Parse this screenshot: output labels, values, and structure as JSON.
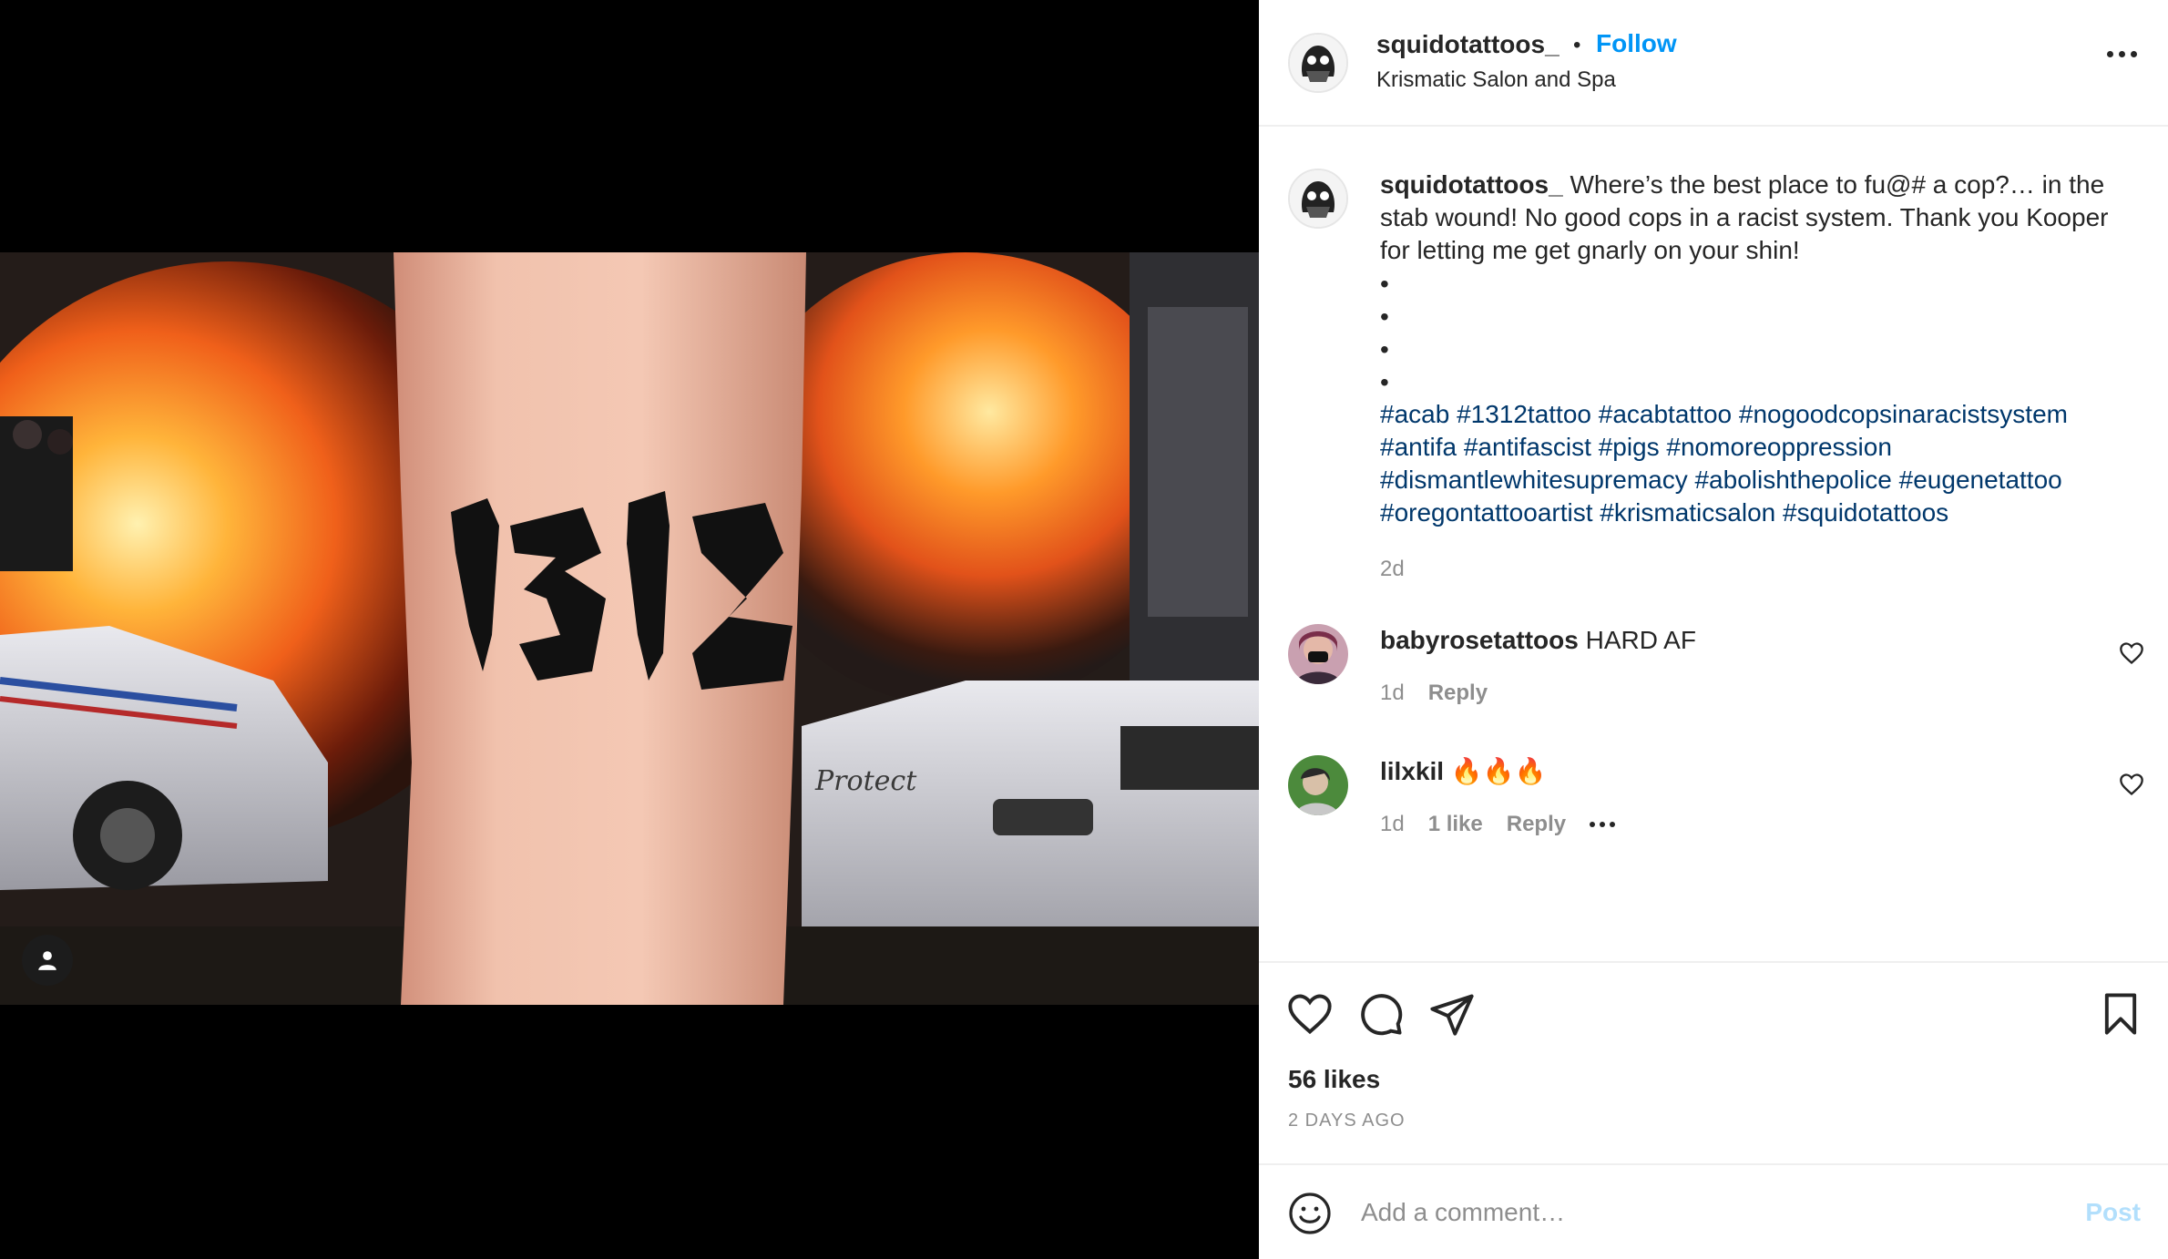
{
  "post": {
    "photo_alt": "Tattoo of 1312 on a shin in front of burning police cars",
    "tattoo_text": "1312"
  },
  "header": {
    "username": "squidotattoos_",
    "separator": "•",
    "follow_label": "Follow",
    "location": "Krismatic Salon and Spa"
  },
  "caption": {
    "username": "squidotattoos_",
    "text": " Where’s the best place to fu@# a cop?… in the stab wound! No good cops in a racist system. Thank you Kooper for letting me get gnarly on your shin!",
    "bullets": [
      "•",
      "•",
      "•",
      "•"
    ],
    "hashtags": "#acab #1312tattoo #acabtattoo #nogoodcopsinaracistsystem #antifa #antifascist #pigs #nomoreoppression #dismantlewhitesupremacy #abolishthepolice #eugenetattoo #oregontattooartist #krismaticsalon #squidotattoos",
    "time": "2d"
  },
  "comments": [
    {
      "username": "babyrosetattoos",
      "text": " HARD AF",
      "time": "1d",
      "likes": "",
      "reply": "Reply"
    },
    {
      "username": "lilxkil",
      "text": " 🔥🔥🔥",
      "time": "1d",
      "likes": "1 like",
      "reply": "Reply"
    }
  ],
  "footer": {
    "likes": "56 likes",
    "posted": "2 DAYS AGO",
    "comment_placeholder": "Add a comment…",
    "post_label": "Post"
  },
  "icons": [
    "heart-icon",
    "comment-icon",
    "share-icon",
    "bookmark-icon",
    "emoji-icon",
    "more-icon",
    "user-tag-icon"
  ]
}
